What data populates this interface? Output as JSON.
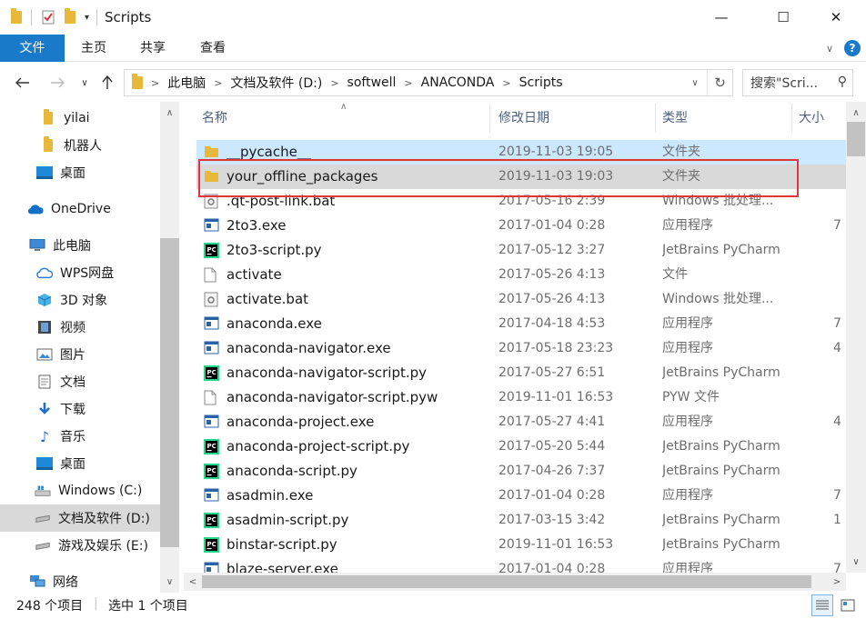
{
  "window": {
    "title": "Scripts",
    "minimize_glyph": "—",
    "maximize_glyph": "☐",
    "close_glyph": "✕"
  },
  "ribbon": {
    "tabs": [
      "文件",
      "主页",
      "共享",
      "查看"
    ],
    "help_glyph": "?"
  },
  "address": {
    "segments": [
      "此电脑",
      "文档及软件 (D:)",
      "softwell",
      "ANACONDA",
      "Scripts"
    ],
    "search_placeholder": "搜索\"Scri..."
  },
  "sidebar": {
    "items": [
      {
        "label": "yilai",
        "icon": "folder-icon"
      },
      {
        "label": "机器人",
        "icon": "folder-icon"
      },
      {
        "label": "桌面",
        "icon": "desktop-icon"
      },
      {
        "label": "OneDrive",
        "icon": "cloud-icon"
      },
      {
        "label": "此电脑",
        "icon": "computer-icon"
      },
      {
        "label": "WPS网盘",
        "icon": "wps-cloud-icon"
      },
      {
        "label": "3D 对象",
        "icon": "cube-icon"
      },
      {
        "label": "视频",
        "icon": "video-icon"
      },
      {
        "label": "图片",
        "icon": "picture-icon"
      },
      {
        "label": "文档",
        "icon": "document-icon"
      },
      {
        "label": "下载",
        "icon": "download-icon"
      },
      {
        "label": "音乐",
        "icon": "music-icon"
      },
      {
        "label": "桌面",
        "icon": "desktop-icon"
      },
      {
        "label": "Windows (C:)",
        "icon": "drive-c-icon"
      },
      {
        "label": "文档及软件 (D:)",
        "icon": "drive-icon"
      },
      {
        "label": "游戏及娱乐 (E:)",
        "icon": "drive-icon"
      },
      {
        "label": "网络",
        "icon": "network-icon"
      }
    ],
    "selected_index": 14
  },
  "filelist": {
    "columns": [
      "名称",
      "修改日期",
      "类型",
      "大小"
    ],
    "rows": [
      {
        "name": "__pycache__",
        "date": "2019-11-03 19:05",
        "type": "文件夹",
        "size": "",
        "icon": "folder"
      },
      {
        "name": "your_offline_packages",
        "date": "2019-11-03 19:03",
        "type": "文件夹",
        "size": "",
        "icon": "folder"
      },
      {
        "name": ".qt-post-link.bat",
        "date": "2017-05-16 2:39",
        "type": "Windows 批处理...",
        "size": "",
        "icon": "bat"
      },
      {
        "name": "2to3.exe",
        "date": "2017-01-04 0:28",
        "type": "应用程序",
        "size": "7",
        "icon": "exe"
      },
      {
        "name": "2to3-script.py",
        "date": "2017-05-12 3:27",
        "type": "JetBrains PyCharm",
        "size": "",
        "icon": "pycharm"
      },
      {
        "name": "activate",
        "date": "2017-05-26 4:13",
        "type": "文件",
        "size": "",
        "icon": "file"
      },
      {
        "name": "activate.bat",
        "date": "2017-05-26 4:13",
        "type": "Windows 批处理...",
        "size": "",
        "icon": "bat"
      },
      {
        "name": "anaconda.exe",
        "date": "2017-04-18 4:53",
        "type": "应用程序",
        "size": "7",
        "icon": "exe"
      },
      {
        "name": "anaconda-navigator.exe",
        "date": "2017-05-18 23:23",
        "type": "应用程序",
        "size": "4",
        "icon": "exe"
      },
      {
        "name": "anaconda-navigator-script.py",
        "date": "2017-05-27 6:51",
        "type": "JetBrains PyCharm",
        "size": "",
        "icon": "pycharm"
      },
      {
        "name": "anaconda-navigator-script.pyw",
        "date": "2019-11-01 16:53",
        "type": "PYW 文件",
        "size": "",
        "icon": "file"
      },
      {
        "name": "anaconda-project.exe",
        "date": "2017-05-27 4:41",
        "type": "应用程序",
        "size": "4",
        "icon": "exe"
      },
      {
        "name": "anaconda-project-script.py",
        "date": "2017-05-20 5:44",
        "type": "JetBrains PyCharm",
        "size": "",
        "icon": "pycharm"
      },
      {
        "name": "anaconda-script.py",
        "date": "2017-04-26 7:37",
        "type": "JetBrains PyCharm",
        "size": "",
        "icon": "pycharm"
      },
      {
        "name": "asadmin.exe",
        "date": "2017-01-04 0:28",
        "type": "应用程序",
        "size": "7",
        "icon": "exe"
      },
      {
        "name": "asadmin-script.py",
        "date": "2017-03-15 3:42",
        "type": "JetBrains PyCharm",
        "size": "1",
        "icon": "pycharm"
      },
      {
        "name": "binstar-script.py",
        "date": "2019-11-01 16:53",
        "type": "JetBrains PyCharm",
        "size": "",
        "icon": "pycharm"
      },
      {
        "name": "blaze-server.exe",
        "date": "2017-01-04 0:28",
        "type": "应用程序",
        "size": "7",
        "icon": "exe"
      }
    ],
    "hover_index": 0,
    "selected_index": 1
  },
  "status": {
    "item_count": "248 个项目",
    "selection": "选中 1 个项目"
  },
  "colors": {
    "accent": "#1979ca",
    "folder": "#e8b83b",
    "highlight_border": "#e0353c",
    "hover_row": "#cce8ff",
    "selected_row": "#d9d9d9"
  }
}
